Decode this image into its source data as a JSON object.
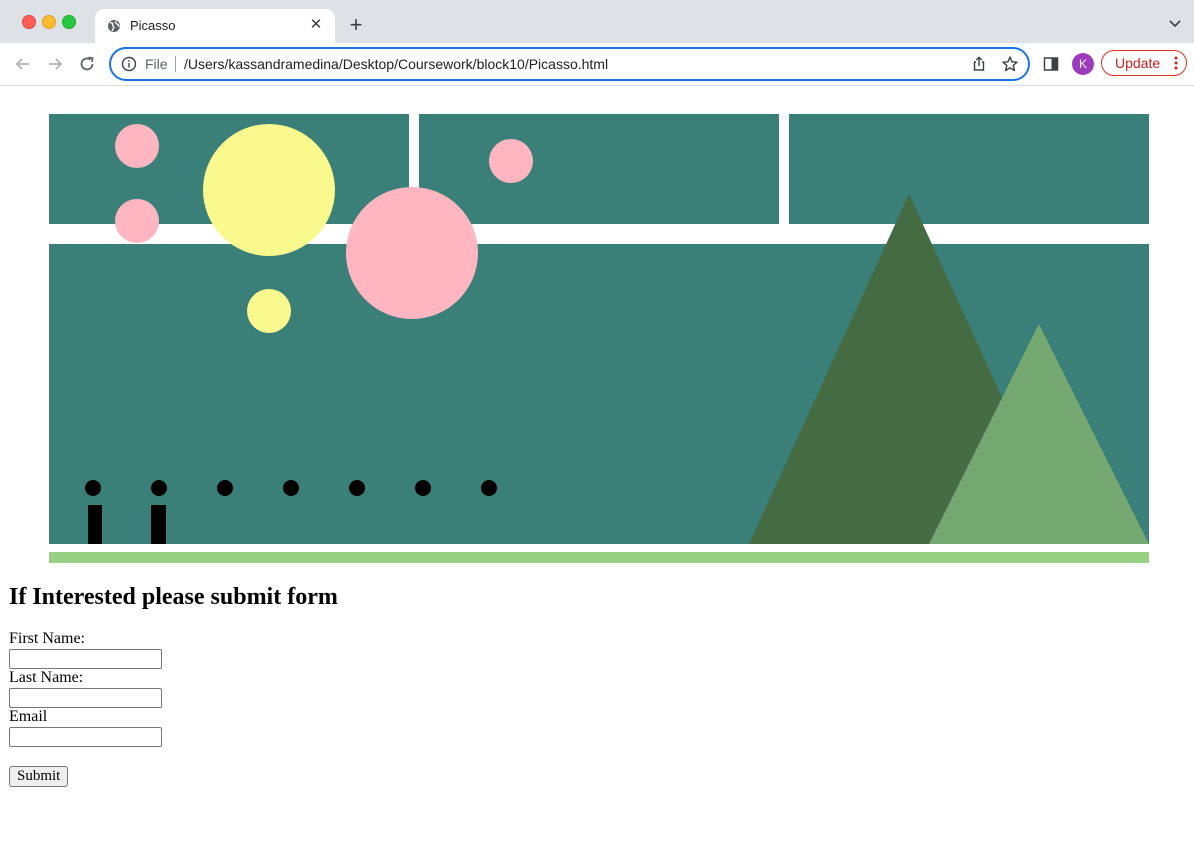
{
  "browser": {
    "tab": {
      "title": "Picasso"
    },
    "address_bar": {
      "scheme_label": "File",
      "url": "/Users/kassandramedina/Desktop/Coursework/block10/Picasso.html"
    },
    "profile_initial": "K",
    "update_label": "Update"
  },
  "icons": {
    "favicon": "globe-icon",
    "close": "close-icon",
    "new_tab": "plus-icon",
    "tab_list": "chevron-down-icon",
    "back": "back-arrow-icon",
    "forward": "forward-arrow-icon",
    "reload": "reload-icon",
    "site_info": "info-icon",
    "share": "share-icon",
    "bookmark": "star-icon",
    "side_panel": "side-panel-icon",
    "menu": "kebab-menu-icon"
  },
  "colors": {
    "panel": "#3b7f79",
    "pink": "#ffb6c1",
    "yellow": "#f9f98d",
    "dark_mountain": "#456b43",
    "light_mountain": "#74a870",
    "ground": "#98d184",
    "figure": "#000000",
    "address_focus": "#1a73e8",
    "update_red": "#d93025",
    "avatar": "#9c3bbd"
  },
  "form": {
    "heading": "If Interested please submit form",
    "first_name_label": "First Name:",
    "last_name_label": "Last Name:",
    "email_label": "Email",
    "submit_label": "Submit"
  }
}
